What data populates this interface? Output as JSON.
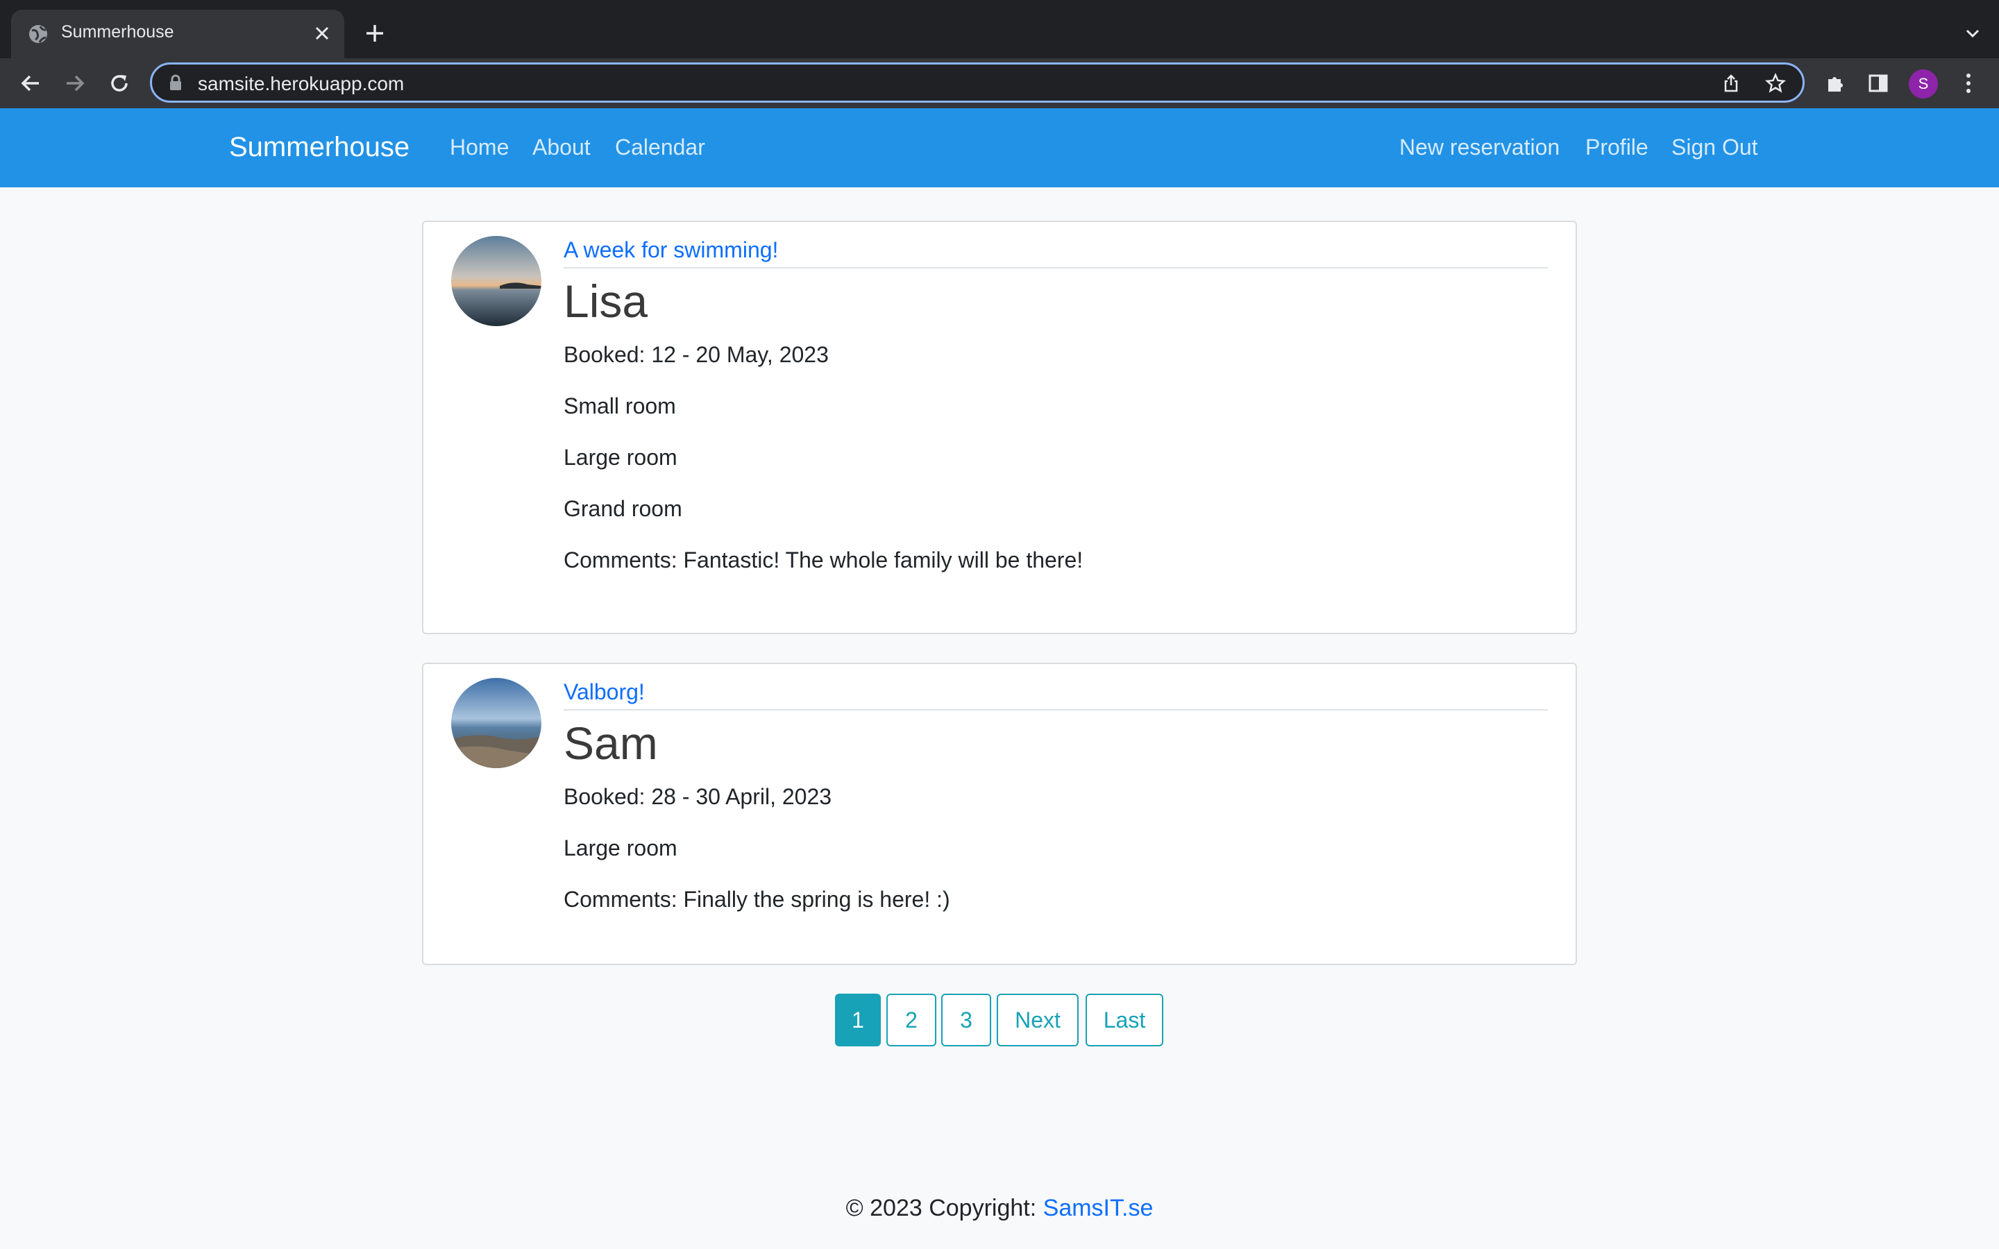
{
  "browser": {
    "tab_title": "Summerhouse",
    "url": "samsite.herokuapp.com",
    "profile_initial": "S"
  },
  "navbar": {
    "brand": "Summerhouse",
    "left_links": [
      "Home",
      "About",
      "Calendar"
    ],
    "right_links": [
      "New reservation",
      "Profile",
      "Sign Out"
    ],
    "color": "#2192e6"
  },
  "reservations": [
    {
      "title": "A week for swimming!",
      "name": "Lisa",
      "booked": "Booked: 12 - 20 May, 2023",
      "rooms": [
        "Small room",
        "Large room",
        "Grand room"
      ],
      "comments": "Comments: Fantastic! The whole family will be there!"
    },
    {
      "title": "Valborg!",
      "name": "Sam",
      "booked": "Booked: 28 - 30 April, 2023",
      "rooms": [
        "Large room"
      ],
      "comments": "Comments: Finally the spring is here! :)"
    }
  ],
  "pagination": {
    "pages": [
      "1",
      "2",
      "3"
    ],
    "active": "1",
    "next": "Next",
    "last": "Last",
    "color": "#17a2b8"
  },
  "footer": {
    "text": "© 2023 Copyright: ",
    "link": "SamsIT.se"
  }
}
